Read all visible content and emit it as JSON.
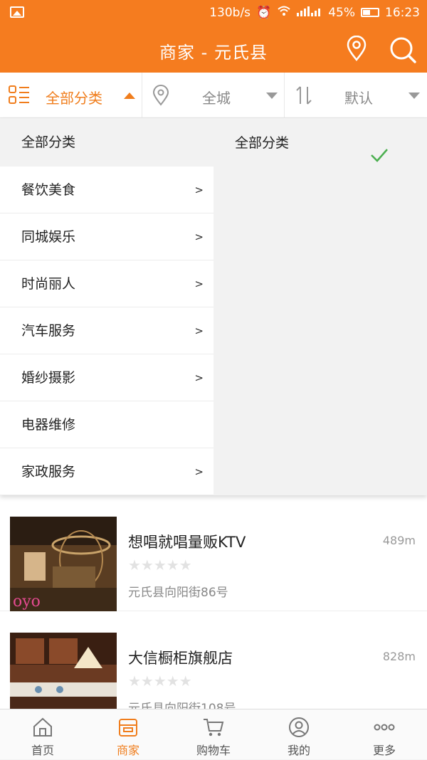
{
  "status_bar": {
    "speed": "130b/s",
    "battery": "45%",
    "time": "16:23"
  },
  "header": {
    "title": "商家 - 元氏县",
    "location_icon": "location-pin-icon",
    "search_icon": "search-icon"
  },
  "filters": {
    "category": "全部分类",
    "area": "全城",
    "sort": "默认"
  },
  "dropdown": {
    "left_header": "全部分类",
    "categories": [
      {
        "label": "餐饮美食",
        "arrow": ">"
      },
      {
        "label": "同城娱乐",
        "arrow": ">"
      },
      {
        "label": "时尚丽人",
        "arrow": ">"
      },
      {
        "label": "汽车服务",
        "arrow": ">"
      },
      {
        "label": "婚纱摄影",
        "arrow": ">"
      },
      {
        "label": "电器维修",
        "arrow": ""
      },
      {
        "label": "家政服务",
        "arrow": ">"
      }
    ],
    "right_items": [
      {
        "label": "全部分类",
        "selected": true
      }
    ]
  },
  "listings": [
    {
      "name": "想唱就唱量贩KTV",
      "distance": "489m",
      "rating": 0,
      "stars": "★★★★★",
      "address": "元氏县向阳街86号"
    },
    {
      "name": "大信橱柜旗舰店",
      "distance": "828m",
      "rating": 0,
      "stars": "★★★★★",
      "address": "元氏县向阳街108号"
    }
  ],
  "bottom_nav": [
    {
      "label": "首页",
      "icon": "home-icon"
    },
    {
      "label": "商家",
      "icon": "shop-icon",
      "active": true
    },
    {
      "label": "购物车",
      "icon": "cart-icon"
    },
    {
      "label": "我的",
      "icon": "user-icon"
    },
    {
      "label": "更多",
      "icon": "more-icon"
    }
  ],
  "colors": {
    "brand": "#f57c1f",
    "active": "#f07d1c",
    "check": "#4caf50"
  }
}
